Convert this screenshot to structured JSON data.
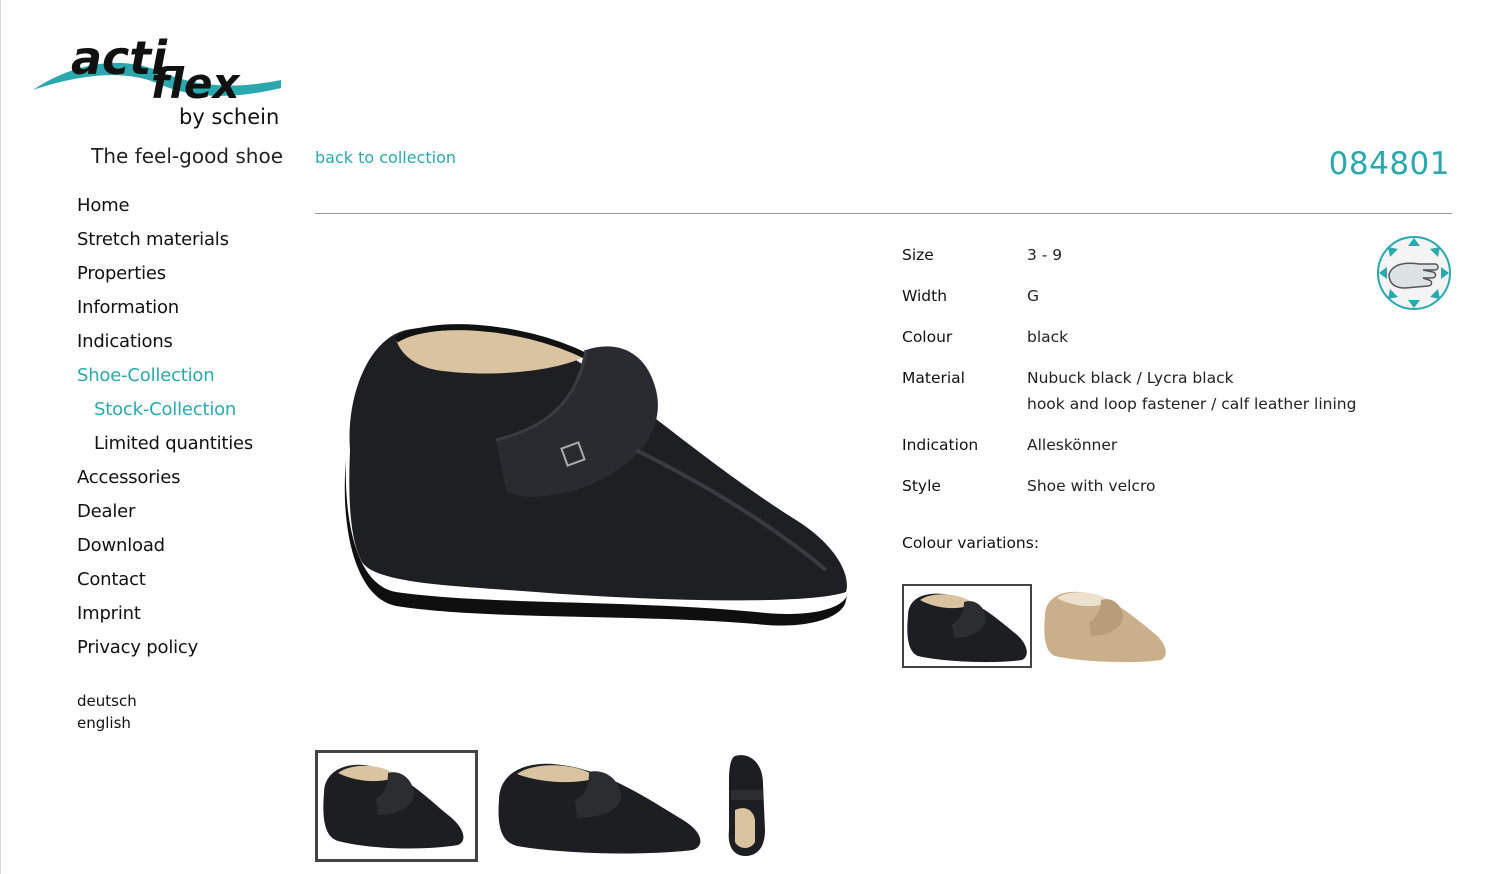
{
  "brand": {
    "logo_word_1": "acti",
    "logo_word_2": "flex",
    "logo_by": "by schein",
    "tagline": "The feel-good shoe",
    "accent_color": "#2aa8ad"
  },
  "nav": {
    "items": [
      {
        "label": "Home"
      },
      {
        "label": "Stretch materials"
      },
      {
        "label": "Properties"
      },
      {
        "label": "Information"
      },
      {
        "label": "Indications"
      },
      {
        "label": "Shoe-Collection"
      },
      {
        "label": "Stock-Collection"
      },
      {
        "label": "Limited quantities"
      },
      {
        "label": "Accessories"
      },
      {
        "label": "Dealer"
      },
      {
        "label": "Download"
      },
      {
        "label": "Contact"
      },
      {
        "label": "Imprint"
      },
      {
        "label": "Privacy policy"
      }
    ],
    "languages": [
      {
        "label": "deutsch"
      },
      {
        "label": "english"
      }
    ]
  },
  "product": {
    "back_link": "back to collection",
    "article_number": "084801",
    "specs": {
      "size_label": "Size",
      "size": "3 - 9",
      "width_label": "Width",
      "width": "G",
      "colour_label": "Colour",
      "colour": "black",
      "material_label": "Material",
      "material_line_1": "Nubuck black / Lycra black",
      "material_line_2": "hook and loop fastener / calf leather lining",
      "indication_label": "Indication",
      "indication": "Alleskönner",
      "style_label": "Style",
      "style": "Shoe with velcro"
    },
    "colour_variations_label": "Colour variations:",
    "colour_variations": [
      {
        "colour": "black",
        "hex": "#1d1e22",
        "selected": true
      },
      {
        "colour": "beige",
        "hex": "#c9b08a",
        "selected": false
      }
    ],
    "thumbnails": [
      {
        "view": "side-angle",
        "selected": true
      },
      {
        "view": "side",
        "selected": false
      },
      {
        "view": "top",
        "selected": false
      }
    ],
    "icon": "stretch-hand-icon"
  }
}
